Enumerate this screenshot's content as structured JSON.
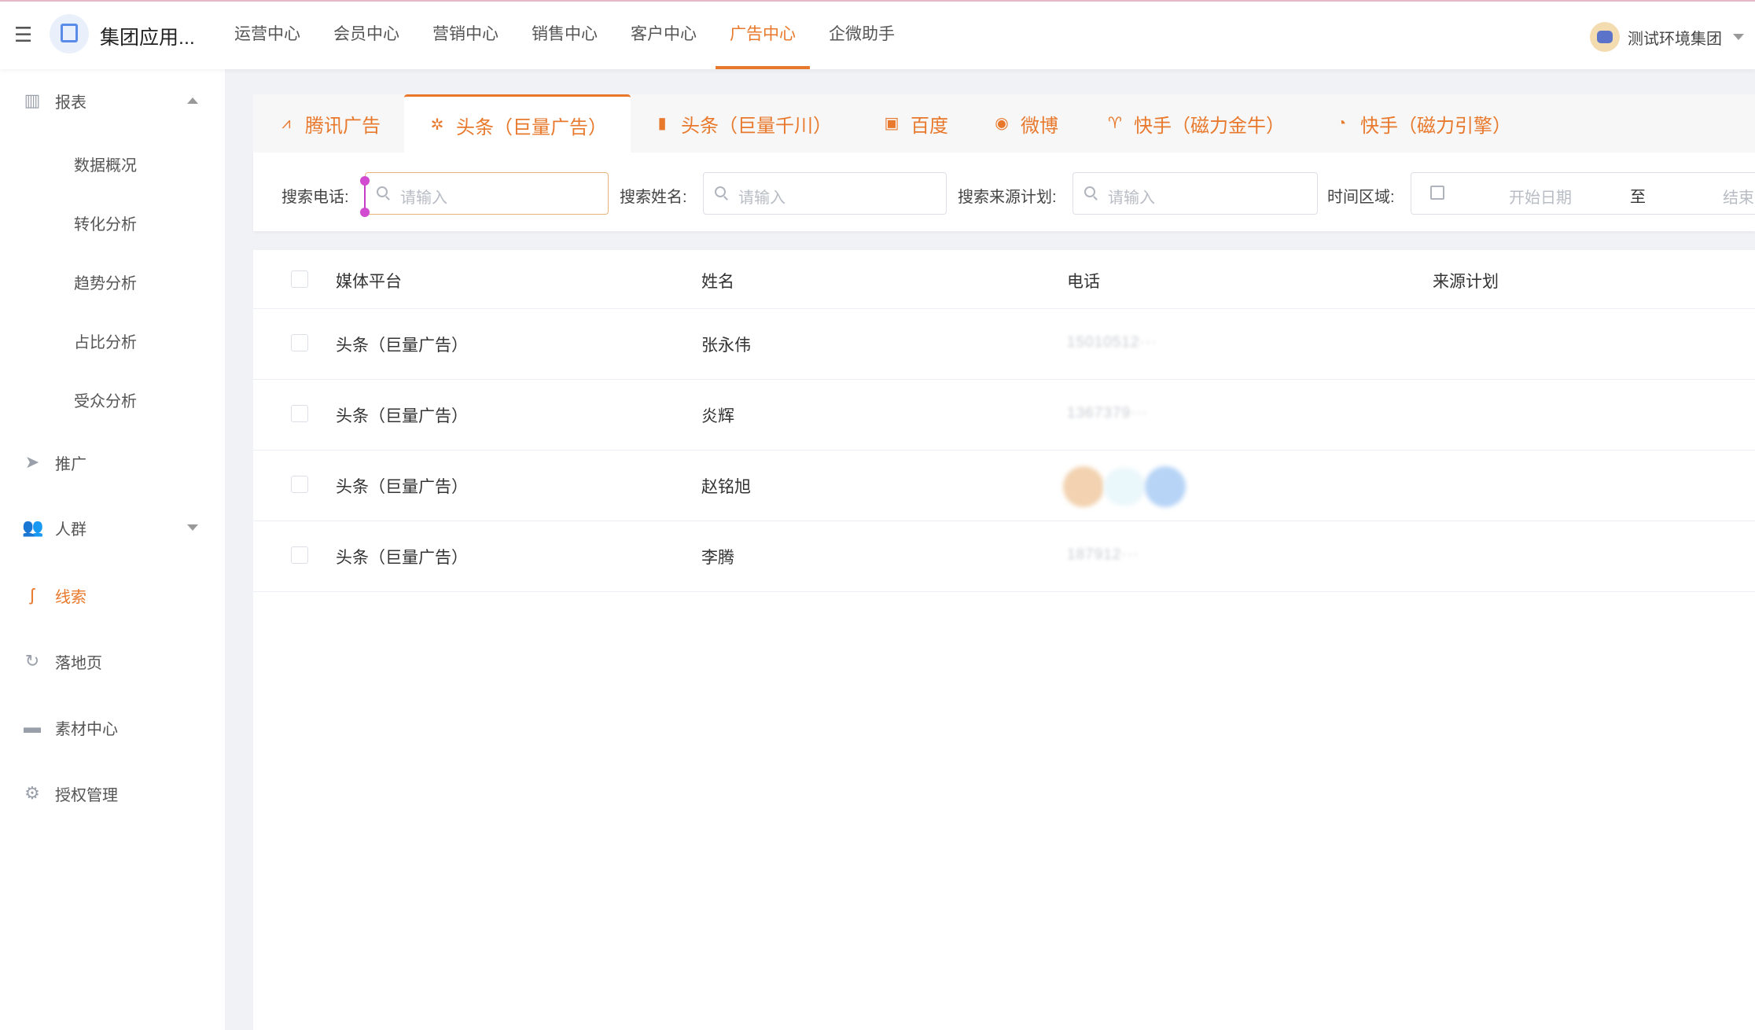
{
  "header": {
    "app_title": "集团应用...",
    "nav": [
      {
        "label": "运营中心",
        "active": false
      },
      {
        "label": "会员中心",
        "active": false
      },
      {
        "label": "营销中心",
        "active": false
      },
      {
        "label": "销售中心",
        "active": false
      },
      {
        "label": "客户中心",
        "active": false
      },
      {
        "label": "广告中心",
        "active": true
      },
      {
        "label": "企微助手",
        "active": false
      }
    ],
    "org_name": "测试环境集团"
  },
  "sidebar": {
    "report": {
      "label": "报表",
      "icon": "bar-chart-icon"
    },
    "sub_items": [
      "数据概况",
      "转化分析",
      "趋势分析",
      "占比分析",
      "受众分析"
    ],
    "items": [
      {
        "label": "推广",
        "icon": "paper-plane-icon"
      },
      {
        "label": "人群",
        "icon": "users-icon"
      },
      {
        "label": "线索",
        "icon": "clue-icon",
        "active": true
      },
      {
        "label": "落地页",
        "icon": "landing-icon"
      },
      {
        "label": "素材中心",
        "icon": "folder-icon"
      },
      {
        "label": "授权管理",
        "icon": "gear-icon"
      }
    ]
  },
  "tabs": [
    {
      "label": "腾讯广告",
      "icon": "tencent-icon"
    },
    {
      "label": "头条（巨量广告）",
      "icon": "toutiao-icon",
      "active": true
    },
    {
      "label": "头条（巨量千川）",
      "icon": "qianchuan-icon"
    },
    {
      "label": "百度",
      "icon": "baidu-icon"
    },
    {
      "label": "微博",
      "icon": "weibo-icon"
    },
    {
      "label": "快手（磁力金牛）",
      "icon": "kuaishou-icon"
    },
    {
      "label": "快手（磁力引擎）",
      "icon": "kuaishou-engine-icon"
    }
  ],
  "filters": {
    "phone_label": "搜索电话:",
    "name_label": "搜索姓名:",
    "plan_label": "搜索来源计划:",
    "time_label": "时间区域:",
    "placeholder": "请输入",
    "start_date": "开始日期",
    "range_sep": "至",
    "end_date": "结束"
  },
  "table": {
    "columns": [
      "媒体平台",
      "姓名",
      "电话",
      "来源计划"
    ],
    "rows": [
      {
        "platform": "头条（巨量广告）",
        "name": "张永伟",
        "phone": "15010512···"
      },
      {
        "platform": "头条（巨量广告）",
        "name": "炎辉",
        "phone": "1367379···"
      },
      {
        "platform": "头条（巨量广告）",
        "name": "赵铭旭",
        "phone": ""
      },
      {
        "platform": "头条（巨量广告）",
        "name": "李腾",
        "phone": "187912···"
      }
    ]
  }
}
